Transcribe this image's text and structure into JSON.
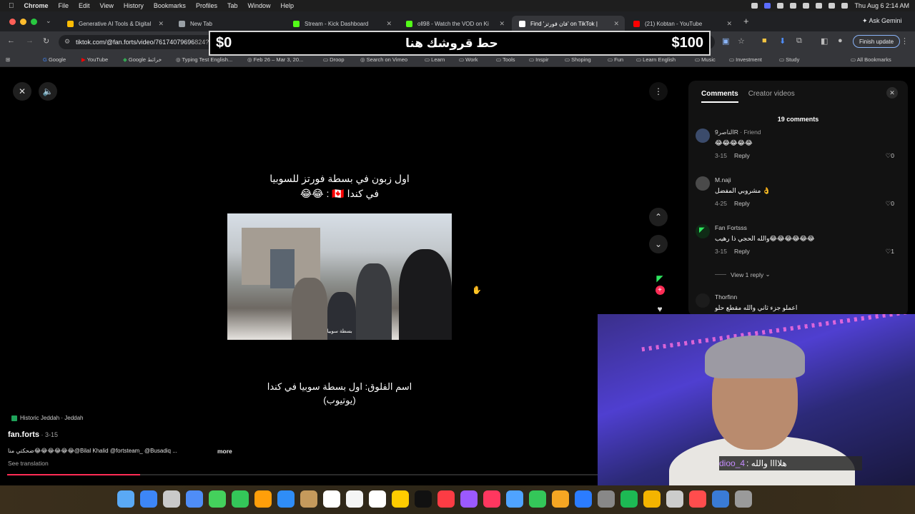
{
  "menubar": {
    "items": [
      "Chrome",
      "File",
      "Edit",
      "View",
      "History",
      "Bookmarks",
      "Profiles",
      "Tab",
      "Window",
      "Help"
    ],
    "clock": "Thu Aug 6  2:14 AM"
  },
  "tabs": [
    {
      "title": "Generative AI Tools & Digital",
      "color": "#fbbc04"
    },
    {
      "title": "New Tab",
      "color": "#9aa0a6"
    },
    {
      "title": "Stream - Kick Dashboard",
      "color": "#53fc18"
    },
    {
      "title": "oll98 - Watch the VOD on Ki",
      "color": "#53fc18"
    },
    {
      "title": "Find 'فان فورتز' on TikTok |",
      "color": "#ffffff"
    },
    {
      "title": "(21) Kobtan - YouTube",
      "color": "#ff0000"
    }
  ],
  "toolbar": {
    "url": "tiktok.com/@fan.forts/video/76174079696",
    "url_tail": "824?q=فورتز%20فان&t=1785993592805",
    "ask_gemini": "Ask Gemini",
    "finish_update": "Finish update"
  },
  "banner": {
    "left": "$0",
    "middle": "حط قروشك هنا",
    "right": "$100"
  },
  "bookmarks": [
    "Google",
    "YouTube",
    "Google خرائط",
    "Typing Test English...",
    "Feb 26 – Mar 3, 20...",
    "Droop",
    "Search on Vimeo",
    "Learn",
    "Work",
    "Tools",
    "Inspir",
    "Shoping",
    "Fun",
    "Learn English",
    "Music",
    "Investment",
    "Study",
    "All Bookmarks"
  ],
  "video": {
    "caption_top_1": "اول زبون في بسطة فورتز للسوبيا",
    "caption_top_2": "في كندا 🇨🇦 : 😂😂",
    "subtitle": "بسطة سوبيا",
    "caption_bottom_1": "اسم الفلوق: اول بسطة سوبيا في كندا",
    "caption_bottom_2": "(يوتيوب)"
  },
  "post": {
    "location": "Historic Jeddah · Jeddah",
    "username": "fan.forts",
    "date": " · 3-15",
    "description": "ضحكتي منا😂😂😂😂😂😂@Bilal Khalid @fortsteam_ @Busadiq ...",
    "more": "more",
    "see_translation": "See translation",
    "progress": 0.225
  },
  "comments_panel": {
    "tab_comments": "Comments",
    "tab_creator": "Creator videos",
    "count": "19 comments",
    "items": [
      {
        "name": "الناصر9R",
        "friend": " · Friend",
        "text": "😂😂😂😂😂",
        "date": "3-15",
        "reply": "Reply",
        "likes": "0"
      },
      {
        "name": "M.naji",
        "friend": "",
        "text": "مشروبي المفضل 👌",
        "date": "4-25",
        "reply": "Reply",
        "likes": "0"
      },
      {
        "name": "Fan Fortsss",
        "friend": "",
        "text": "والله الحجي ذا رهيب😂😂😂😂😂😂",
        "date": "3-15",
        "reply": "Reply",
        "likes": "1"
      },
      {
        "name": "Thorfinn",
        "friend": "",
        "text": "اعملو جزء ثاني والله مقطع حلو",
        "date": "",
        "reply": "",
        "likes": ""
      }
    ],
    "view_reply": "View 1 reply"
  },
  "stream_chat": {
    "user": "dioo_4",
    "message": "هلاااا والله :"
  },
  "dock_colors": [
    "#5aa9f5",
    "#3d86f7",
    "#c9c9c9",
    "#4f8df7",
    "#44d15c",
    "#34c759",
    "#ff9f0a",
    "#2f8df7",
    "#c59a5c",
    "#ffffff",
    "#f5f5f5",
    "#ffffff",
    "#ffcc00",
    "#111111",
    "#fc3c44",
    "#9b59ff",
    "#ff375f",
    "#4fa3ff",
    "#34c759",
    "#f5a623",
    "#2b7cff",
    "#888888",
    "#1db954",
    "#f4b400",
    "#cccccc",
    "#ff4d4d",
    "#3a7bd5",
    "#9a9a9a"
  ]
}
